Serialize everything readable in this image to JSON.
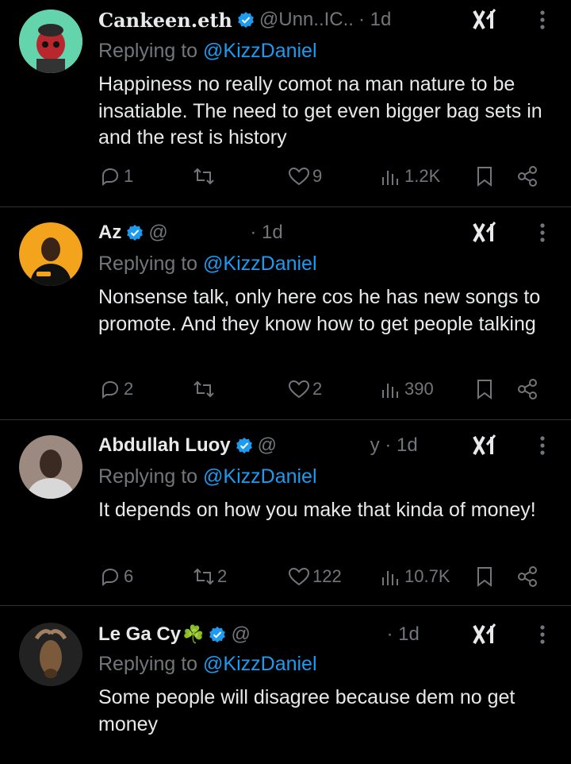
{
  "colors": {
    "background": "#000000",
    "text": "#e7e9ea",
    "muted": "#71767b",
    "accent": "#1d9bf0",
    "divider": "#2f3336"
  },
  "icons": [
    "verified-badge-icon",
    "grok-icon",
    "more-icon",
    "reply-icon",
    "retweet-icon",
    "like-icon",
    "views-icon",
    "bookmark-icon",
    "share-icon"
  ],
  "replying_prefix": "Replying to",
  "tweets": [
    {
      "name": "Cankeen.eth",
      "handle": "@Unn..IC..",
      "time": "· 1d",
      "replying_to": "@KizzDaniel",
      "text": "Happiness no really comot na man nature to be insatiable. The need to get even bigger bag sets in and the rest is history",
      "replies": "1",
      "retweets": "",
      "likes": "9",
      "views": "1.2K"
    },
    {
      "name": "Az",
      "handle": "@",
      "time": "· 1d",
      "replying_to": "@KizzDaniel",
      "text": "Nonsense talk, only here cos he has new songs to promote. And they know how to get people talking",
      "replies": "2",
      "retweets": "",
      "likes": "2",
      "views": "390"
    },
    {
      "name": "Abdullah Luoy",
      "handle": "@",
      "time": "y · 1d",
      "replying_to": "@KizzDaniel",
      "text": "It depends on how you make that kinda of money!",
      "replies": "6",
      "retweets": "2",
      "likes": "122",
      "views": "10.7K"
    },
    {
      "name": "Le Ga Cy",
      "name_emoji": "☘️",
      "handle": "@",
      "time": "· 1d",
      "replying_to": "@KizzDaniel",
      "text": "Some people will disagree because dem no get money",
      "replies": "",
      "retweets": "",
      "likes": "",
      "views": ""
    }
  ]
}
